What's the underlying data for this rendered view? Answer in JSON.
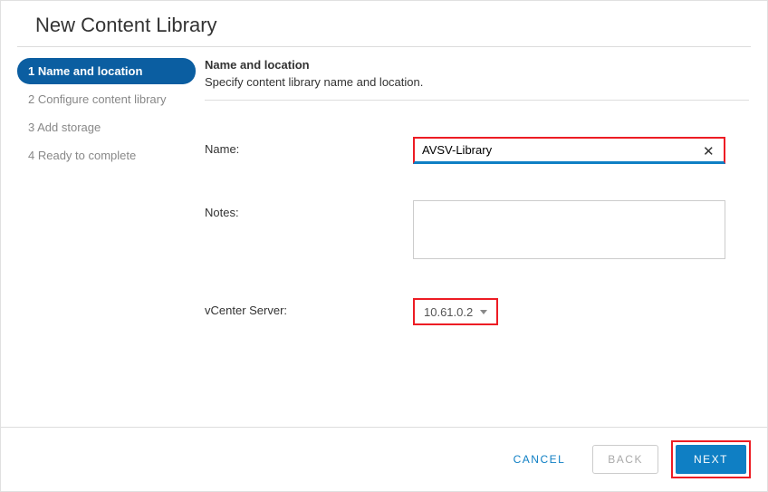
{
  "wizard": {
    "title": "New Content Library",
    "steps": [
      {
        "label": "1 Name and location",
        "active": true
      },
      {
        "label": "2 Configure content library",
        "active": false
      },
      {
        "label": "3 Add storage",
        "active": false
      },
      {
        "label": "4 Ready to complete",
        "active": false
      }
    ]
  },
  "section": {
    "heading": "Name and location",
    "subtext": "Specify content library name and location."
  },
  "form": {
    "name_label": "Name:",
    "name_value": "AVSV-Library",
    "notes_label": "Notes:",
    "notes_value": "",
    "vcenter_label": "vCenter Server:",
    "vcenter_value": "10.61.0.2"
  },
  "footer": {
    "cancel": "CANCEL",
    "back": "BACK",
    "next": "NEXT"
  }
}
